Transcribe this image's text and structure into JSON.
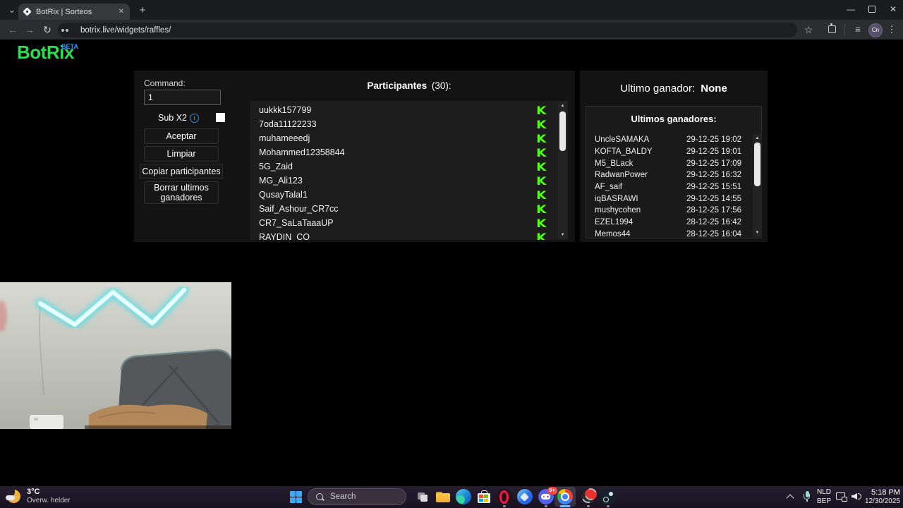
{
  "browser": {
    "tab_title": "BotRix | Sorteos",
    "url": "botrix.live/widgets/raffles/",
    "profile_initials": "Cn"
  },
  "site": {
    "logo_text": "BotRix",
    "beta_badge": "BETA"
  },
  "command_panel": {
    "label": "Command:",
    "input_value": "1",
    "sub_label": "Sub X2",
    "sub_checked": false,
    "buttons": [
      "Aceptar",
      "Limpiar",
      "Copiar participantes",
      "Borrar ultimos ganadores"
    ]
  },
  "participants": {
    "title": "Participantes",
    "count_text": "(30):",
    "platform_icon_glyph": "K",
    "items": [
      "uukkk157799",
      "7oda11122233",
      "muhameeedj",
      "Mohammed12358844",
      "5G_Zaid",
      "MG_Ali123",
      "QusayTalal1",
      "Saif_Ashour_CR7cc",
      "CR7_SaLaTaaaUP",
      "RAYDIN_CO"
    ]
  },
  "winners": {
    "header_label": "Ultimo ganador:",
    "header_value": "None",
    "box_title": "Ultimos ganadores:",
    "items": [
      {
        "name": "UncleSAMAKA",
        "time": "29-12-25 19:02"
      },
      {
        "name": "KOFTA_BALDY",
        "time": "29-12-25 19:01"
      },
      {
        "name": "M5_BLack",
        "time": "29-12-25 17:09"
      },
      {
        "name": "RadwanPower",
        "time": "29-12-25 16:32"
      },
      {
        "name": "AF_saif",
        "time": "29-12-25 15:51"
      },
      {
        "name": "iqBASRAWI",
        "time": "29-12-25 14:55"
      },
      {
        "name": "mushycohen",
        "time": "28-12-25 17:56"
      },
      {
        "name": "EZEL1994",
        "time": "28-12-25 16:42"
      },
      {
        "name": "Memos44",
        "time": "28-12-25 16:04"
      }
    ]
  },
  "taskbar": {
    "weather_temp": "3°C",
    "weather_condition": "Overw. helder",
    "search_label": "Search",
    "discord_badge": "9+",
    "language_top": "NLD",
    "language_bottom": "BEP",
    "time": "5:18 PM",
    "date": "12/30/2025"
  },
  "colors": {
    "kick_green": "#53fc18",
    "logo_green": "#2edb55",
    "beta_blue": "#2d9cf4",
    "badge_red": "#f23f42"
  }
}
